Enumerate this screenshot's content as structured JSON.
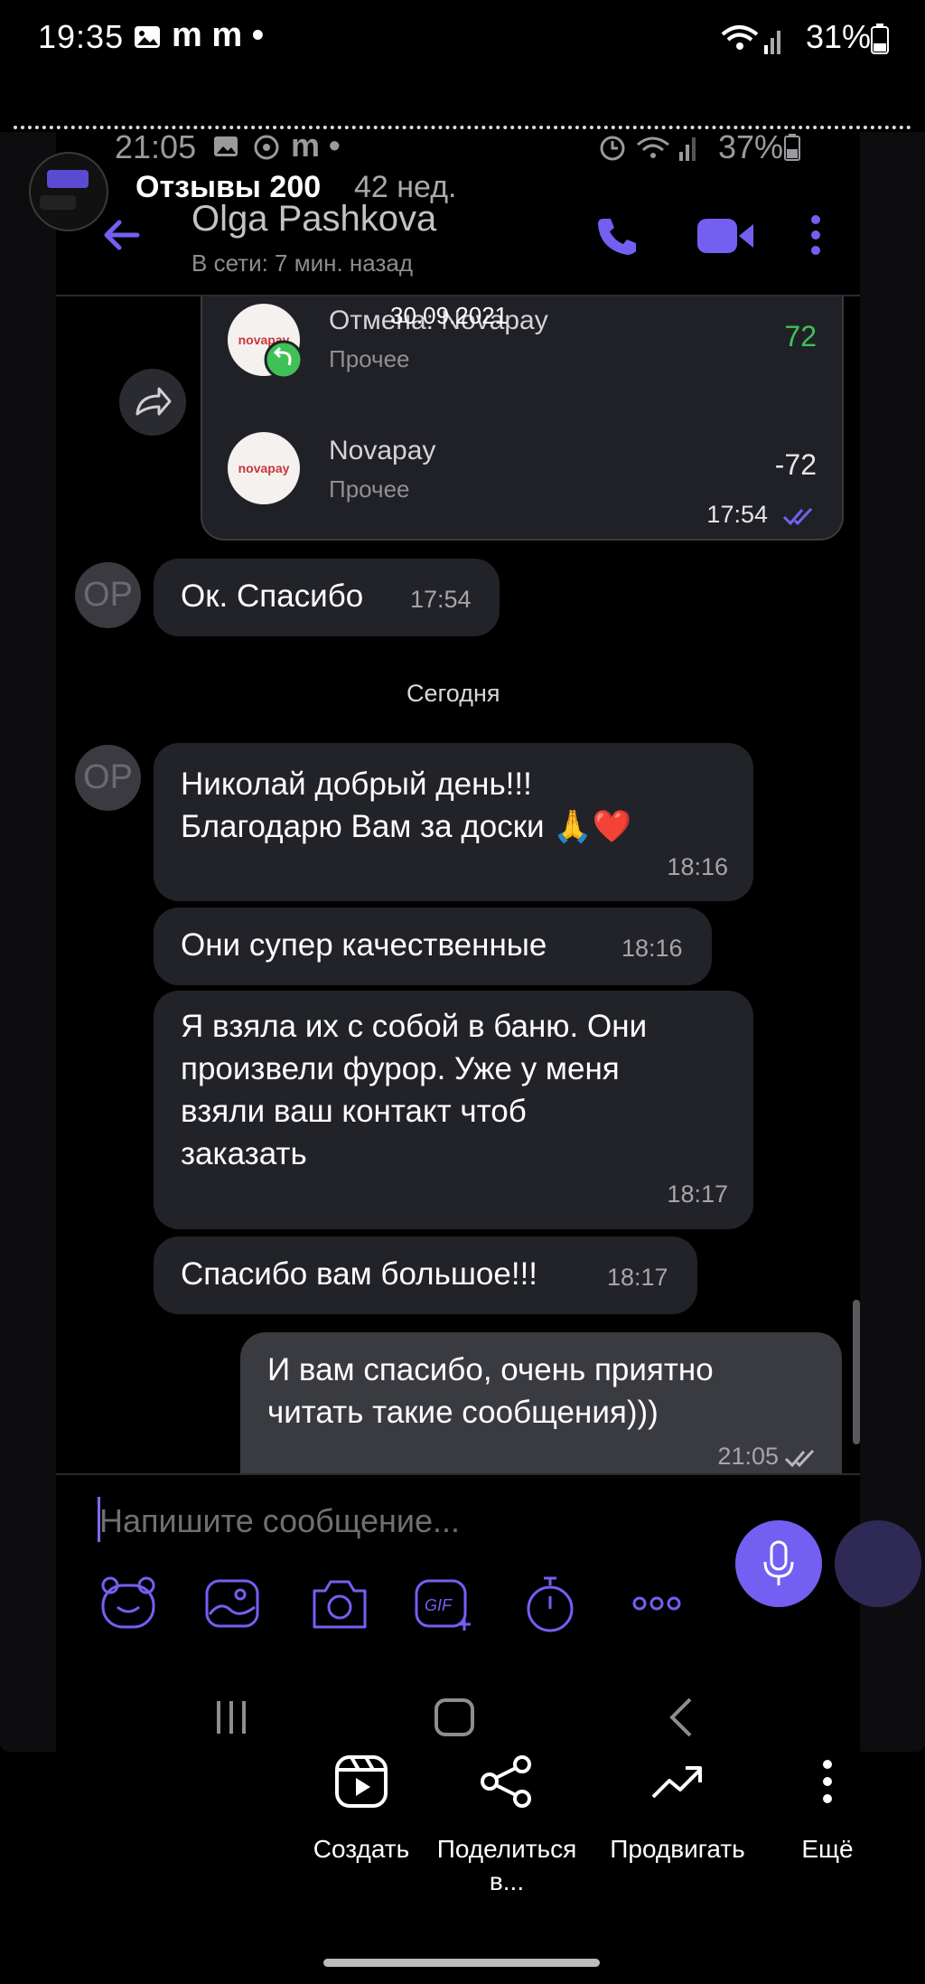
{
  "os_status": {
    "time": "19:35",
    "notif_text": "m m •",
    "battery": "31%"
  },
  "inner_status": {
    "time": "21:05",
    "notif_text": "m •",
    "battery": "37%"
  },
  "story": {
    "title": "Отзывы 200",
    "age": "42 нед."
  },
  "chat_header": {
    "contact_name": "Olga Pashkova",
    "last_seen": "В сети: 7 мин. назад"
  },
  "transactions": {
    "date_overlay": "30.09.2021",
    "items": [
      {
        "name": "Отмена: Novapay",
        "category": "Прочее",
        "amount": "72",
        "logo": "novapay"
      },
      {
        "name": "Novapay",
        "category": "Прочее",
        "amount": "-72",
        "logo": "novapay"
      }
    ],
    "time": "17:54"
  },
  "messages_before": [
    {
      "avatar": "OP",
      "text": "Ок. Спасибо",
      "time": "17:54"
    }
  ],
  "date_separator": "Сегодня",
  "messages_today": [
    {
      "avatar": "OP",
      "text_line1": "Николай добрый день!!!",
      "text_line2": "Благодарю Вам за доски 🙏❤️",
      "time": "18:16"
    },
    {
      "text": "Они супер качественные",
      "time": "18:16"
    },
    {
      "line1": "Я взяла их с собой в баню. Они",
      "line2": "произвели фурор. Уже у меня",
      "line3": "взяли ваш контакт чтоб",
      "line4": "заказать",
      "time": "18:17"
    },
    {
      "text": "Спасибо вам большое!!!",
      "time": "18:17"
    }
  ],
  "outgoing": {
    "line1": "И вам спасибо, очень приятно",
    "line2": "читать такие сообщения)))",
    "time": "21:05"
  },
  "composer": {
    "placeholder": "Напишите сообщение..."
  },
  "toolbar_icons": [
    "sticker-icon",
    "gallery-icon",
    "camera-icon",
    "gif-icon",
    "timer-icon",
    "more-icon"
  ],
  "actions": [
    {
      "label": "Создать",
      "icon": "reel-icon"
    },
    {
      "label": "Поделиться в...",
      "icon": "share-icon"
    },
    {
      "label": "Продвигать",
      "icon": "trend-icon"
    },
    {
      "label": "Ещё",
      "icon": "more-vert-icon"
    }
  ],
  "colors": {
    "accent": "#7360f2",
    "bubble_in": "#222328",
    "bubble_out": "#3a3b41",
    "positive": "#3fc155"
  }
}
